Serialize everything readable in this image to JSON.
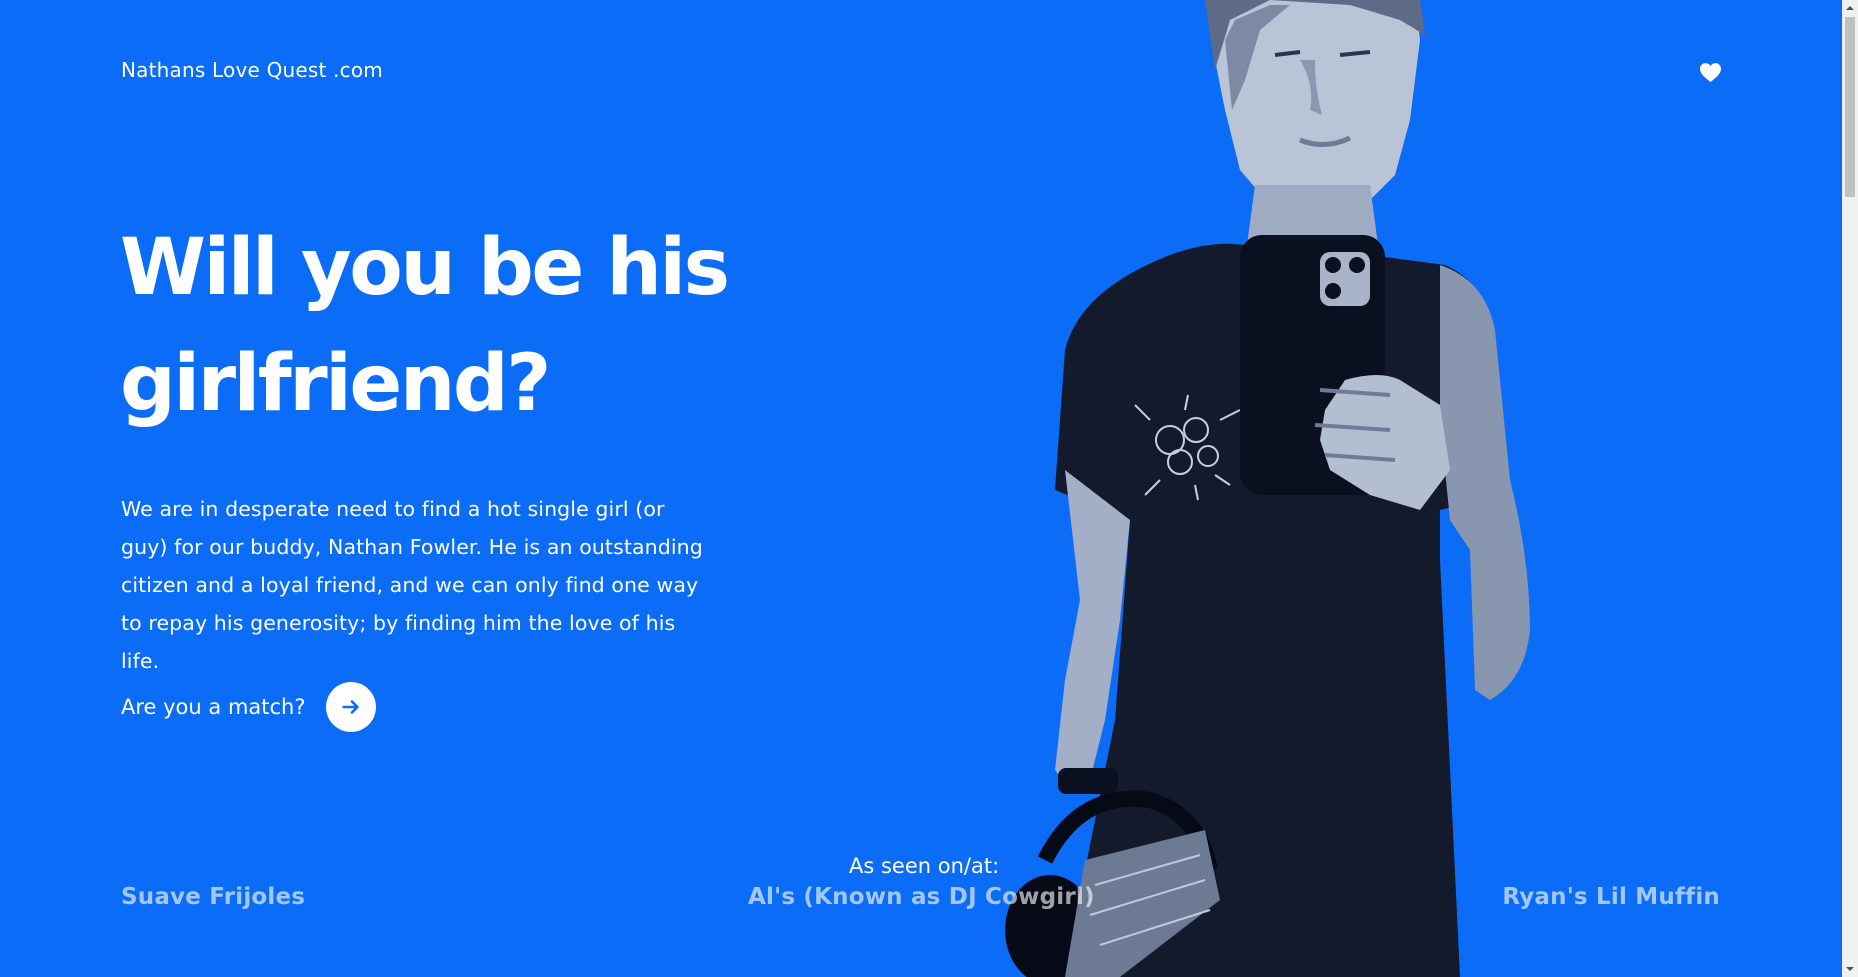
{
  "header": {
    "site_title": "Nathans Love Quest .com",
    "heart_icon": "heart-icon"
  },
  "hero": {
    "title": "Will you be his girlfriend?",
    "body": "We are in desperate need to find a hot single girl (or guy) for our buddy, Nathan Fowler. He is an outstanding citizen and a loyal friend, and we can only find one way to repay his generosity; by finding him the love of his life.",
    "cta_label": "Are you a match?",
    "cta_icon": "arrow-right-icon"
  },
  "seen_on": {
    "label": "As seen on/at:",
    "brands": [
      "Suave Frijoles",
      "Al's (Known as DJ Cowgirl)",
      "Ryan's Lil Muffin"
    ]
  },
  "colors": {
    "background": "#0b6cf7",
    "text": "#ffffff",
    "brand_text": "rgba(255,255,255,0.62)"
  }
}
